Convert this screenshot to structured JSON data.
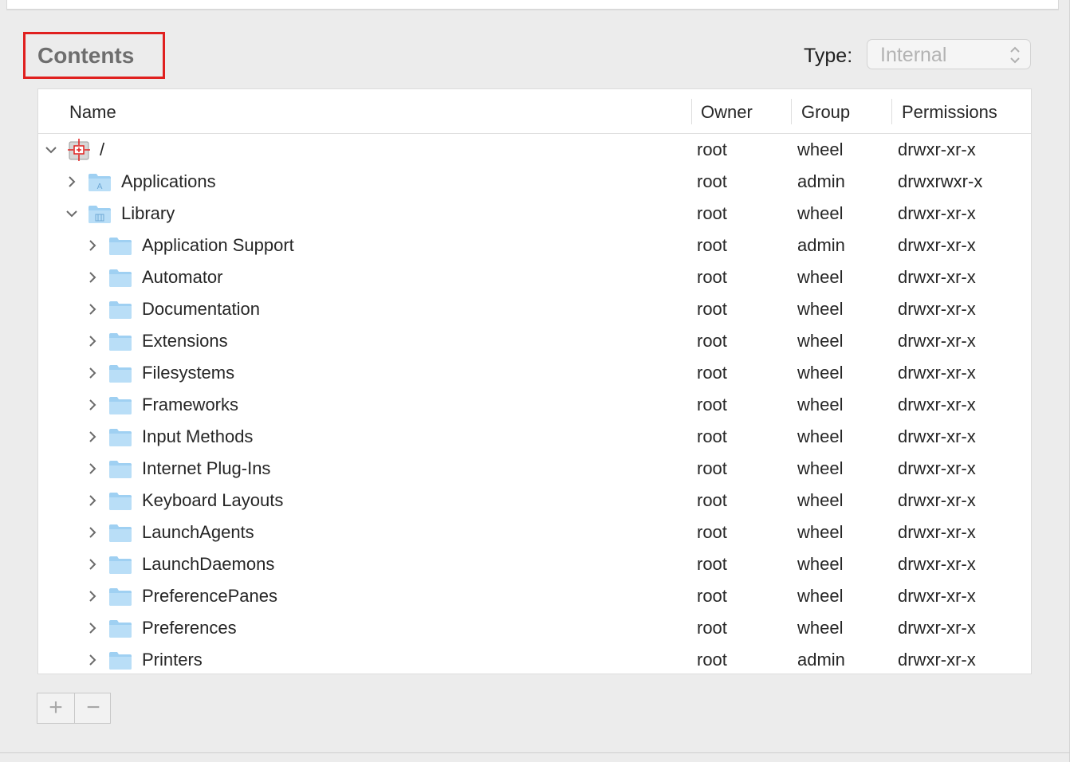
{
  "section": {
    "title": "Contents"
  },
  "type_control": {
    "label": "Type:",
    "value": "Internal"
  },
  "table": {
    "columns": {
      "name": "Name",
      "owner": "Owner",
      "group": "Group",
      "permissions": "Permissions"
    },
    "rows": [
      {
        "name": "/",
        "depth": 0,
        "expanded": true,
        "icon": "disk-icon",
        "owner": "root",
        "group": "wheel",
        "permissions": "drwxr-xr-x"
      },
      {
        "name": "Applications",
        "depth": 1,
        "expanded": false,
        "icon": "applications-folder-icon",
        "owner": "root",
        "group": "admin",
        "permissions": "drwxrwxr-x"
      },
      {
        "name": "Library",
        "depth": 1,
        "expanded": true,
        "icon": "library-folder-icon",
        "owner": "root",
        "group": "wheel",
        "permissions": "drwxr-xr-x"
      },
      {
        "name": "Application Support",
        "depth": 2,
        "expanded": false,
        "icon": "folder-icon",
        "owner": "root",
        "group": "admin",
        "permissions": "drwxr-xr-x"
      },
      {
        "name": "Automator",
        "depth": 2,
        "expanded": false,
        "icon": "folder-icon",
        "owner": "root",
        "group": "wheel",
        "permissions": "drwxr-xr-x"
      },
      {
        "name": "Documentation",
        "depth": 2,
        "expanded": false,
        "icon": "folder-icon",
        "owner": "root",
        "group": "wheel",
        "permissions": "drwxr-xr-x"
      },
      {
        "name": "Extensions",
        "depth": 2,
        "expanded": false,
        "icon": "folder-icon",
        "owner": "root",
        "group": "wheel",
        "permissions": "drwxr-xr-x"
      },
      {
        "name": "Filesystems",
        "depth": 2,
        "expanded": false,
        "icon": "folder-icon",
        "owner": "root",
        "group": "wheel",
        "permissions": "drwxr-xr-x"
      },
      {
        "name": "Frameworks",
        "depth": 2,
        "expanded": false,
        "icon": "folder-icon",
        "owner": "root",
        "group": "wheel",
        "permissions": "drwxr-xr-x"
      },
      {
        "name": "Input Methods",
        "depth": 2,
        "expanded": false,
        "icon": "folder-icon",
        "owner": "root",
        "group": "wheel",
        "permissions": "drwxr-xr-x"
      },
      {
        "name": "Internet Plug-Ins",
        "depth": 2,
        "expanded": false,
        "icon": "folder-icon",
        "owner": "root",
        "group": "wheel",
        "permissions": "drwxr-xr-x"
      },
      {
        "name": "Keyboard Layouts",
        "depth": 2,
        "expanded": false,
        "icon": "folder-icon",
        "owner": "root",
        "group": "wheel",
        "permissions": "drwxr-xr-x"
      },
      {
        "name": "LaunchAgents",
        "depth": 2,
        "expanded": false,
        "icon": "folder-icon",
        "owner": "root",
        "group": "wheel",
        "permissions": "drwxr-xr-x"
      },
      {
        "name": "LaunchDaemons",
        "depth": 2,
        "expanded": false,
        "icon": "folder-icon",
        "owner": "root",
        "group": "wheel",
        "permissions": "drwxr-xr-x"
      },
      {
        "name": "PreferencePanes",
        "depth": 2,
        "expanded": false,
        "icon": "folder-icon",
        "owner": "root",
        "group": "wheel",
        "permissions": "drwxr-xr-x"
      },
      {
        "name": "Preferences",
        "depth": 2,
        "expanded": false,
        "icon": "folder-icon",
        "owner": "root",
        "group": "wheel",
        "permissions": "drwxr-xr-x"
      },
      {
        "name": "Printers",
        "depth": 2,
        "expanded": false,
        "icon": "folder-icon",
        "owner": "root",
        "group": "admin",
        "permissions": "drwxr-xr-x"
      }
    ]
  },
  "buttons": {
    "add": "+",
    "remove": "−"
  },
  "colors": {
    "highlight_box": "#e0201f",
    "folder_blue": "#9fd0f2"
  }
}
